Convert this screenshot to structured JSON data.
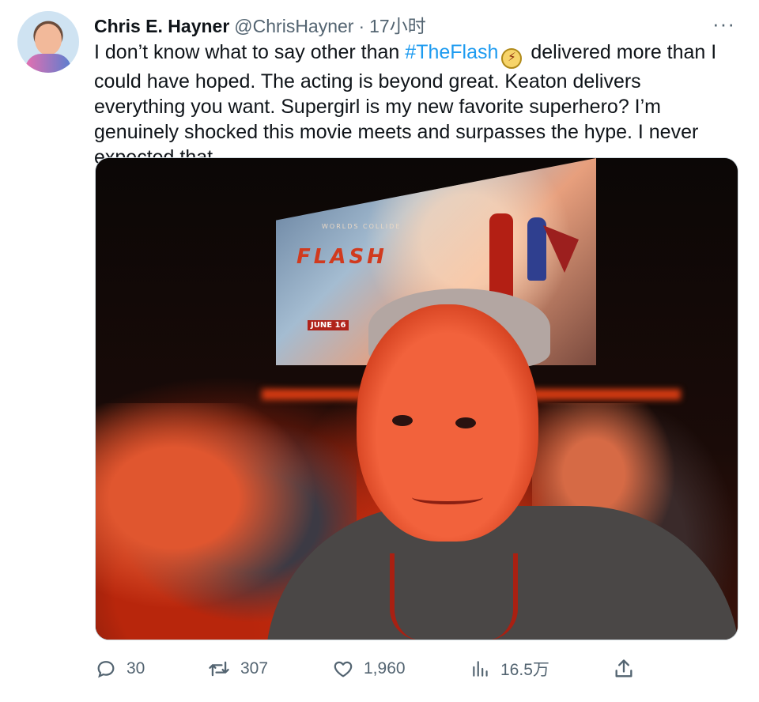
{
  "tweet": {
    "author_name": "Chris E. Hayner",
    "author_handle": "@ChrisHayner",
    "separator": "·",
    "time": "17小时",
    "text_before": "I don’t know what to say other than ",
    "hashtag": "#TheFlash",
    "emoji_name": "lightning-bolt-emoji",
    "text_after": " delivered more than I could have hoped. The acting is beyond great. Keaton delivers everything you want. Supergirl is my new favorite superhero? I’m genuinely shocked this movie meets and surpasses the hype. I never expected that.",
    "more_label": "···"
  },
  "media": {
    "poster_tag": "WORLDS COLLIDE",
    "poster_title": "FLASH",
    "poster_date": "JUNE 16"
  },
  "actions": {
    "reply_count": "30",
    "retweet_count": "307",
    "like_count": "1,960",
    "view_count": "16.5万"
  },
  "colors": {
    "accent": "#1d9bf0",
    "secondary_text": "#536471",
    "primary_text": "#0f1419"
  },
  "icons": [
    "reply-icon",
    "retweet-icon",
    "like-icon",
    "views-icon",
    "share-icon",
    "more-icon"
  ]
}
